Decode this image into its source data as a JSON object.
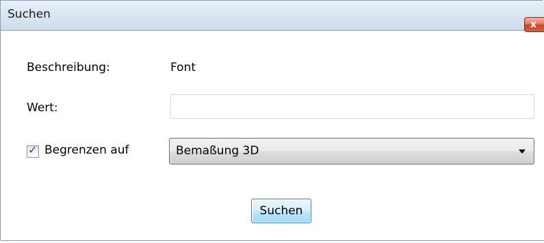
{
  "window": {
    "title": "Suchen",
    "close_glyph": "x"
  },
  "form": {
    "description_label": "Beschreibung:",
    "description_value": "Font",
    "value_label": "Wert:",
    "value_input": "",
    "value_placeholder": "",
    "limit_checkbox_checked": true,
    "limit_checkbox_glyph": "✓",
    "limit_label": "Begrenzen auf",
    "limit_select_value": "Bemaßung 3D"
  },
  "actions": {
    "search_label": "Suchen"
  },
  "icons": {
    "close": "close-icon",
    "dropdown": "chevron-down-icon",
    "check": "checkmark-icon"
  },
  "colors": {
    "close_button": "#d8603f",
    "search_button_border": "#3c7fb1",
    "checkmark": "#2b4aa0"
  }
}
